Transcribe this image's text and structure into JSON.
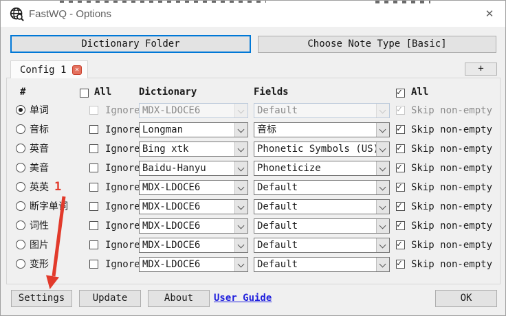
{
  "window": {
    "title": "FastWQ - Options",
    "close_glyph": "✕"
  },
  "toolbar": {
    "dictionary_folder": "Dictionary Folder",
    "choose_note_type": "Choose Note Type [Basic]"
  },
  "tabs": {
    "active_label": "Config 1",
    "close_glyph": "✕",
    "add_label": "+"
  },
  "table": {
    "headers": {
      "num": "#",
      "all_ignore": "All",
      "dictionary": "Dictionary",
      "fields": "Fields",
      "all_skip": "All"
    },
    "ignore_label": "Ignore",
    "skip_label": "Skip non-empty",
    "rows": [
      {
        "label": "单词",
        "selected": true,
        "disabled": true,
        "ignore_checked": false,
        "dictionary": "MDX-LDOCE6",
        "field": "Default",
        "skip_checked": true
      },
      {
        "label": "音标",
        "selected": false,
        "disabled": false,
        "ignore_checked": false,
        "dictionary": "Longman",
        "field": "音标",
        "skip_checked": true
      },
      {
        "label": "英音",
        "selected": false,
        "disabled": false,
        "ignore_checked": false,
        "dictionary": "Bing xtk",
        "field": "Phonetic Symbols (US)",
        "skip_checked": true
      },
      {
        "label": "美音",
        "selected": false,
        "disabled": false,
        "ignore_checked": false,
        "dictionary": "Baidu-Hanyu",
        "field": "Phoneticize",
        "skip_checked": true
      },
      {
        "label": "英英",
        "selected": false,
        "disabled": false,
        "ignore_checked": false,
        "dictionary": "MDX-LDOCE6",
        "field": "Default",
        "skip_checked": true
      },
      {
        "label": "断字单词",
        "selected": false,
        "disabled": false,
        "ignore_checked": false,
        "dictionary": "MDX-LDOCE6",
        "field": "Default",
        "skip_checked": true
      },
      {
        "label": "词性",
        "selected": false,
        "disabled": false,
        "ignore_checked": false,
        "dictionary": "MDX-LDOCE6",
        "field": "Default",
        "skip_checked": true
      },
      {
        "label": "图片",
        "selected": false,
        "disabled": false,
        "ignore_checked": false,
        "dictionary": "MDX-LDOCE6",
        "field": "Default",
        "skip_checked": true
      },
      {
        "label": "变形",
        "selected": false,
        "disabled": false,
        "ignore_checked": false,
        "dictionary": "MDX-LDOCE6",
        "field": "Default",
        "skip_checked": true
      }
    ]
  },
  "footer": {
    "settings": "Settings",
    "update": "Update",
    "about": "About",
    "user_guide": "User Guide",
    "ok": "OK"
  },
  "annotation": {
    "step_number": "1",
    "color": "#e23a2b"
  },
  "colors": {
    "focus_accent": "#0078d7",
    "link": "#2020dd",
    "tab_close_bg": "#e4705e",
    "titlebar_bg": "#ffffff",
    "window_bg": "#f0f0f0"
  }
}
